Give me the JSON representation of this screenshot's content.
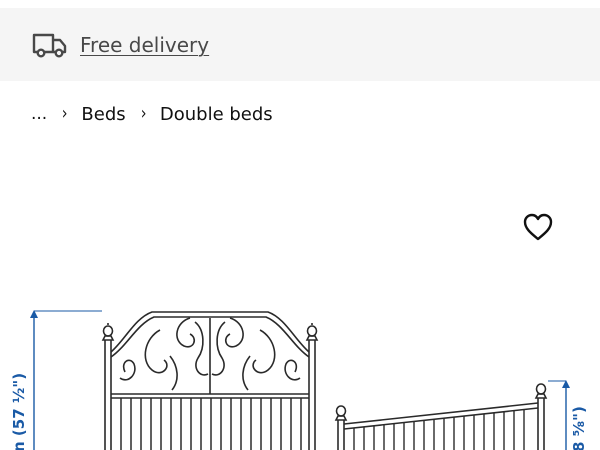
{
  "delivery_banner": {
    "label": "Free delivery",
    "icon": "truck-icon"
  },
  "breadcrumb": {
    "items": [
      {
        "label": "..."
      },
      {
        "label": "Beds"
      },
      {
        "label": "Double beds"
      }
    ],
    "separator_icon": "chevron-right-icon"
  },
  "product": {
    "favourite_icon": "heart-icon",
    "dimension_left": "n (57 ½\")",
    "dimension_right": "8 ⅝\")"
  },
  "colors": {
    "banner_background": "#f5f5f5",
    "dimension_blue": "#1a5aa6",
    "text": "#111111"
  }
}
